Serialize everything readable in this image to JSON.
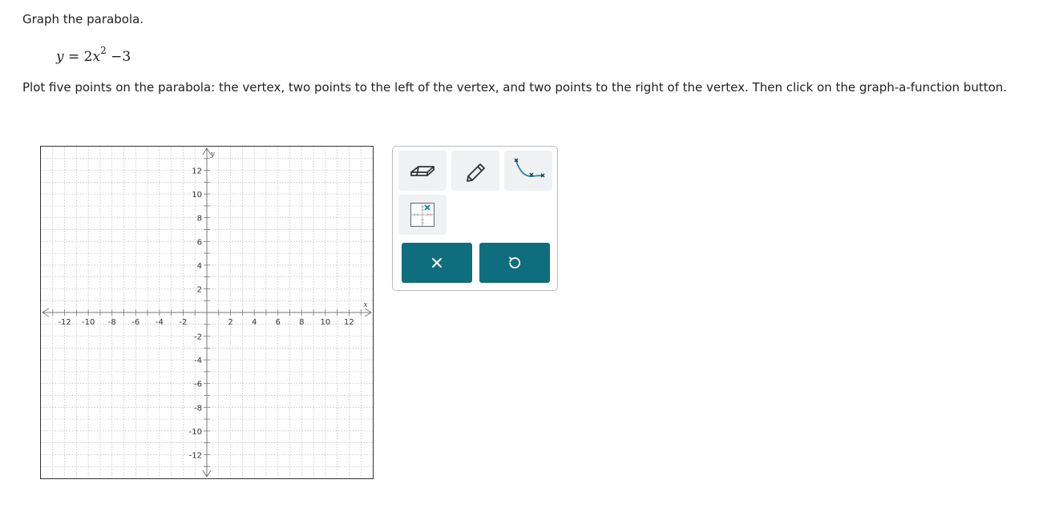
{
  "question": {
    "prompt": "Graph the parabola.",
    "equation": {
      "lhs": "y",
      "equals": "=",
      "coefficient": "2",
      "variable": "x",
      "exponent": "2",
      "constant": "−3"
    },
    "instructions": "Plot five points on the parabola: the vertex, two points to the left of the vertex, and two points to the right of the vertex. Then click on the graph-a-function button."
  },
  "graph": {
    "x_axis_label": "x",
    "y_axis_label": "y",
    "x_range": [
      -14,
      14
    ],
    "y_range": [
      -14,
      14
    ],
    "grid_step": 1,
    "x_tick_labels": [
      "-12",
      "-10",
      "-8",
      "-6",
      "-4",
      "-2",
      "2",
      "4",
      "6",
      "8",
      "10",
      "12"
    ],
    "y_tick_labels": [
      "12",
      "10",
      "8",
      "6",
      "4",
      "2",
      "-2",
      "-4",
      "-6",
      "-8",
      "-10",
      "-12"
    ],
    "grid_color": "#b7b7b7",
    "axis_color": "#777777"
  },
  "toolbox": {
    "tools": [
      {
        "name": "eraser-tool",
        "icon": "eraser-icon"
      },
      {
        "name": "pencil-tool",
        "icon": "pencil-icon"
      },
      {
        "name": "graph-a-function-tool",
        "icon": "graph-function-icon"
      },
      {
        "name": "point-tool",
        "icon": "point-grid-icon"
      }
    ],
    "actions": [
      {
        "name": "clear-button",
        "icon": "close-icon"
      },
      {
        "name": "undo-button",
        "icon": "undo-icon"
      }
    ],
    "accent_color": "#0e6e7d"
  }
}
